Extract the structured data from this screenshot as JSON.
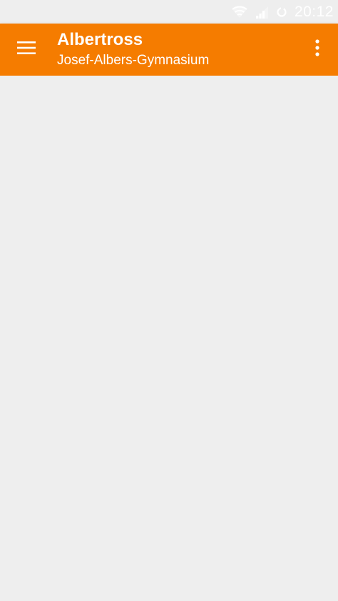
{
  "status_bar": {
    "time": "20:12",
    "icons": [
      "wifi-icon",
      "signal-icon",
      "sync-icon"
    ]
  },
  "app_bar": {
    "title": "Albertross",
    "subtitle": "Josef-Albers-Gymnasium",
    "background_color": "#f57c00",
    "menu_icon": "hamburger-menu-icon",
    "overflow_icon": "more-vert-icon"
  },
  "content": {
    "background_color": "#eeeeee"
  }
}
